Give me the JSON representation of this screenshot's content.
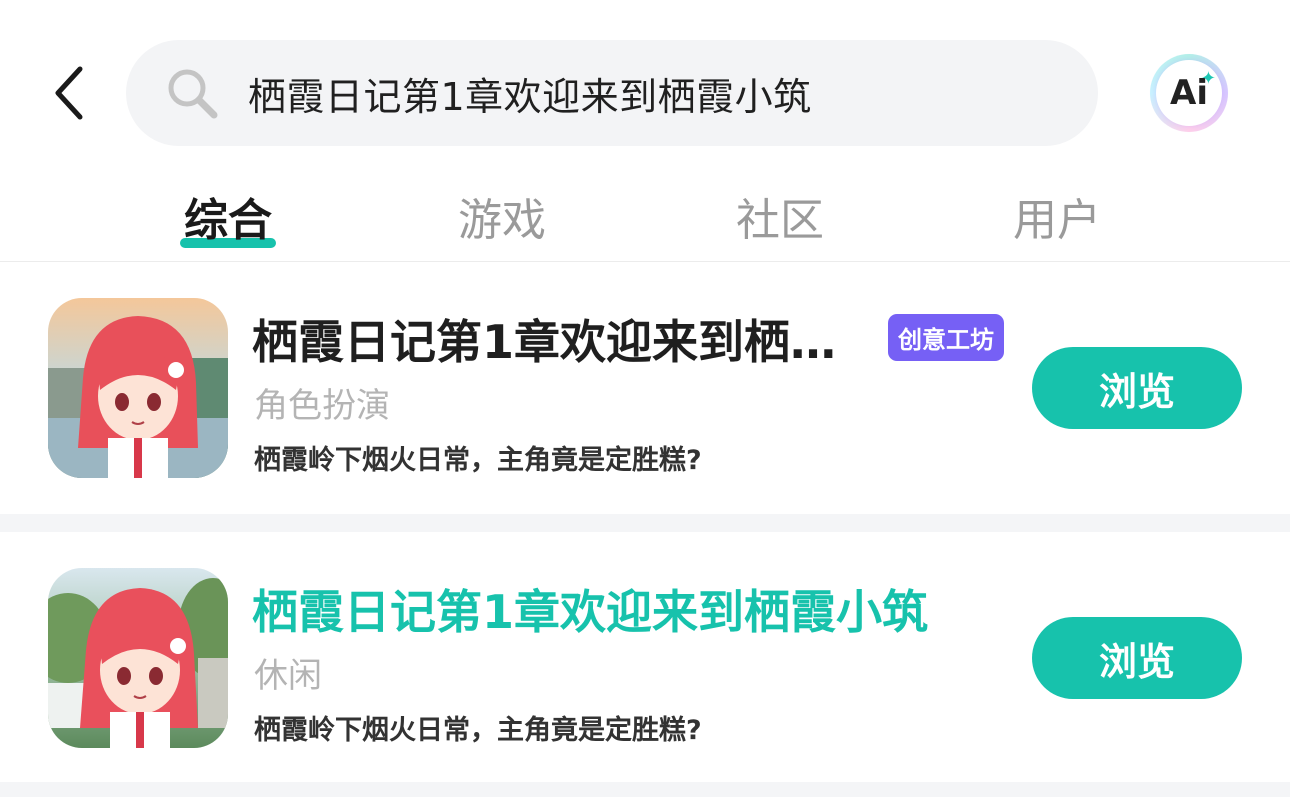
{
  "header": {
    "search_query": "栖霞日记第1章欢迎来到栖霞小筑",
    "ai_label": "Ai"
  },
  "tabs": [
    {
      "label": "综合",
      "active": true
    },
    {
      "label": "游戏",
      "active": false
    },
    {
      "label": "社区",
      "active": false
    },
    {
      "label": "用户",
      "active": false
    }
  ],
  "results": [
    {
      "title": "栖霞日记第1章欢迎来到栖…",
      "badge": "创意工坊",
      "genre": "角色扮演",
      "description": "栖霞岭下烟火日常，主角竟是定胜糕?",
      "button": "浏览",
      "title_color": "#1a1a1a"
    },
    {
      "title": "栖霞日记第1章欢迎来到栖霞小筑",
      "genre": "休闲",
      "description": "栖霞岭下烟火日常，主角竟是定胜糕?",
      "button": "浏览",
      "title_color": "#17c2ac"
    }
  ],
  "colors": {
    "accent": "#17c2ac",
    "badge": "#7660f5"
  }
}
